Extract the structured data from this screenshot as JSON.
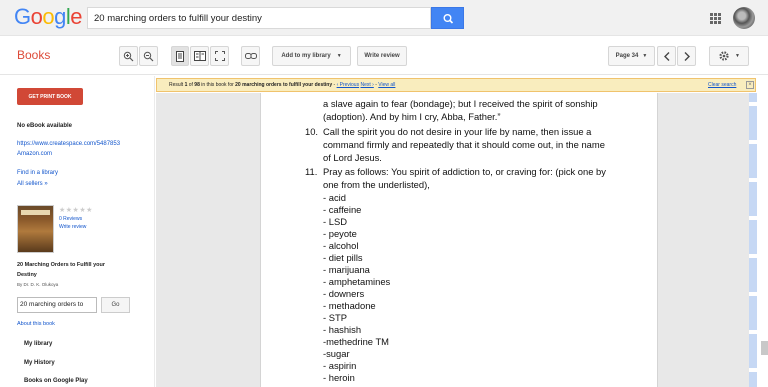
{
  "header": {
    "logo": "Google",
    "search_value": "20 marching orders to fulfill your destiny"
  },
  "toolbar": {
    "books_label": "Books",
    "add_to_library": "Add to my library",
    "write_review": "Write review",
    "page_label": "Page 34"
  },
  "sidebar": {
    "get_print_book": "GET PRINT BOOK",
    "no_ebook": "No eBook available",
    "retailers": [
      "https://www.createspace.com/5487853",
      "Amazon.com"
    ],
    "find_in_library": "Find in a library",
    "all_sellers": "All sellers »",
    "reviews": "0 Reviews",
    "write_review": "Write review",
    "book_title_1": "20 Marching Orders to Fulfill your",
    "book_title_2": "Destiny",
    "author": "By Dr. D. K. Olukoya",
    "inbook_search_value": "20 marching orders to",
    "go": "Go",
    "about": "About this book",
    "my_library": "My library",
    "my_history": "My History",
    "books_on_play": "Books on Google Play"
  },
  "resultbar": {
    "prefix": "Result ",
    "result_num": "1",
    "mid": " of ",
    "total": "98",
    "text": " in this book for ",
    "query": "20 marching orders to fulfill your destiny",
    "sep": " - ",
    "previous": "‹ Previous",
    "next": "Next ›",
    "view_all": "View all",
    "clear": "Clear search"
  },
  "page": {
    "cont_line1": "a slave again to fear (bondage); but I received the spirit of sonship",
    "cont_line2": "(adoption). And by him I cry, Abba, Father.”",
    "item10_num": "10.",
    "item10_l1": "Call the spirit you do not desire in your life by name, then issue a",
    "item10_l2": "command firmly and repeatedly that it should come out, in the name",
    "item10_l3": "of Lord Jesus.",
    "item11_num": "11.",
    "item11_l1": "Pray as follows: You spirit of addiction to, or craving for: (pick one by",
    "item11_l2": "one from the underlisted),",
    "list": [
      "- acid",
      "- caffeine",
      "- LSD",
      "- peyote",
      "- alcohol",
      "- diet pills",
      "- marijuana",
      "- amphetamines",
      "- downers",
      "- methadone",
      "- STP",
      "- hashish",
      "-methedrine TM",
      "-sugar",
      "- aspirin",
      "- heroin"
    ]
  },
  "colors": {
    "accent": "#4285f4",
    "brand_red": "#dd4b39",
    "print_button": "#d14836",
    "link": "#1155cc",
    "result_bar": "#f9edbe"
  }
}
